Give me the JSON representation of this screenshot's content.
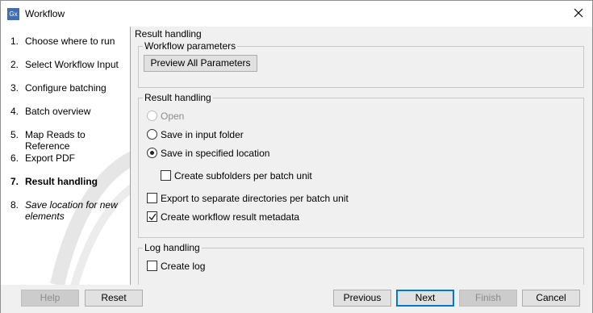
{
  "window": {
    "title": "Workflow",
    "icon_text": "Gx"
  },
  "steps": [
    {
      "num": "1.",
      "label": "Choose where to run"
    },
    {
      "num": "2.",
      "label": "Select Workflow Input"
    },
    {
      "num": "3.",
      "label": "Configure batching"
    },
    {
      "num": "4.",
      "label": "Batch overview"
    },
    {
      "num": "5.",
      "label": "Map Reads to Reference"
    },
    {
      "num": "6.",
      "label": "Export PDF"
    },
    {
      "num": "7.",
      "label": "Result handling"
    },
    {
      "num": "8.",
      "label": "Save location for new elements"
    }
  ],
  "panel": {
    "title": "Result handling",
    "workflow_parameters": {
      "title": "Workflow parameters",
      "preview_button": "Preview All Parameters"
    },
    "result_handling": {
      "title": "Result handling",
      "open": "Open",
      "save_input_folder": "Save in input folder",
      "save_specified": "Save in specified location",
      "create_subfolders": "Create subfolders per batch unit",
      "export_separate": "Export to separate directories per batch unit",
      "create_metadata": "Create workflow result metadata"
    },
    "log_handling": {
      "title": "Log handling",
      "create_log": "Create log"
    }
  },
  "footer": {
    "help": "Help",
    "reset": "Reset",
    "previous": "Previous",
    "next": "Next",
    "finish": "Finish",
    "cancel": "Cancel"
  }
}
